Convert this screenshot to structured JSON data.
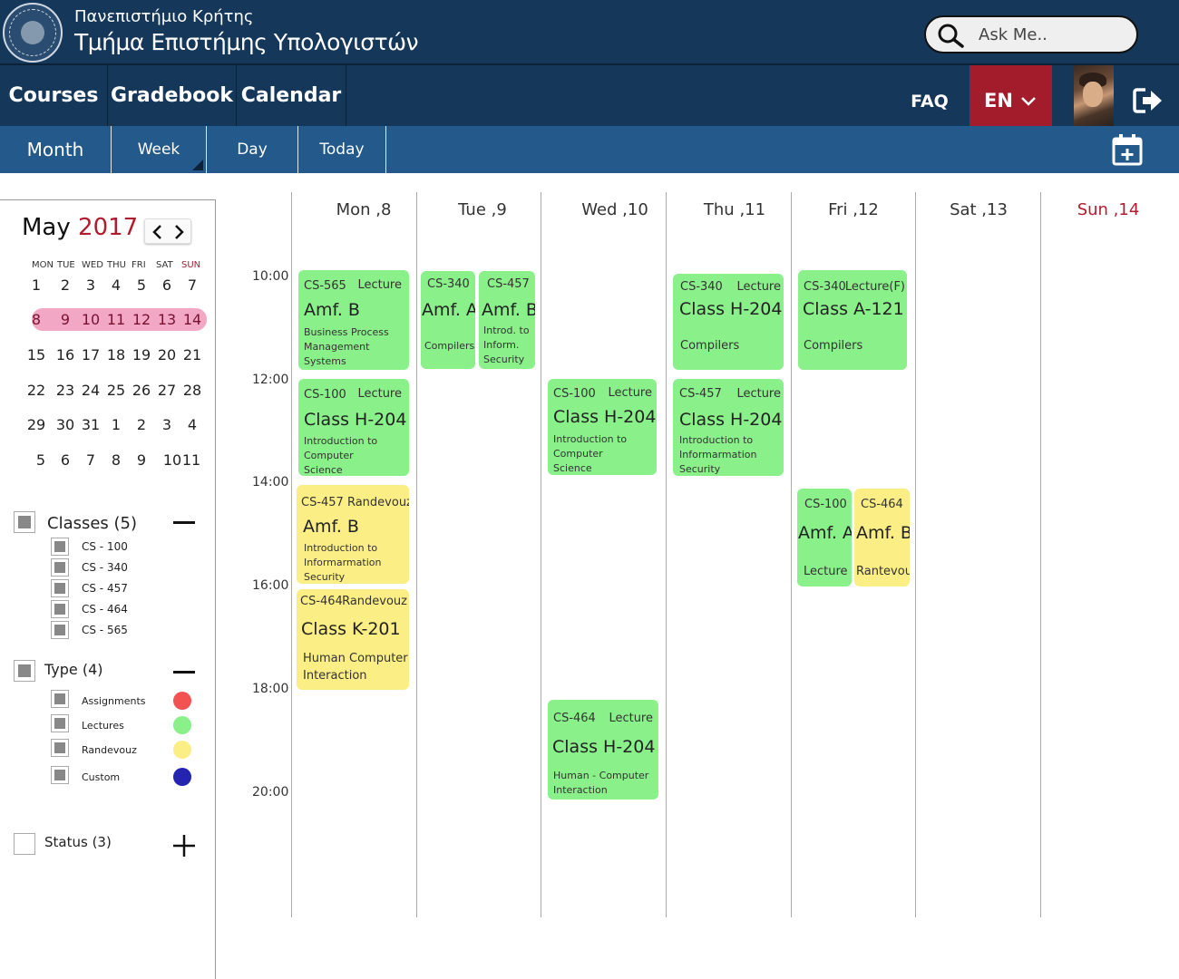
{
  "header": {
    "university": "Πανεπιστήμιο Κρήτης",
    "department": "Τμήμα Επιστήμης Υπολογιστών",
    "search_placeholder": "Ask Me.."
  },
  "nav": {
    "courses": "Courses",
    "gradebook": "Gradebook",
    "calendar": "Calendar",
    "faq": "FAQ",
    "language": "EN"
  },
  "views": {
    "month": "Month",
    "week": "Week",
    "day": "Day",
    "today": "Today"
  },
  "mini_calendar": {
    "month": "May",
    "year": "2017",
    "weekdays": [
      "MON",
      "TUE",
      "WED",
      "THU",
      "FRI",
      "SAT",
      "SUN"
    ],
    "weeks": [
      [
        "1",
        "2",
        "3",
        "4",
        "5",
        "6",
        "7"
      ],
      [
        "8",
        "9",
        "10",
        "11",
        "12",
        "13",
        "14"
      ],
      [
        "15",
        "16",
        "17",
        "18",
        "19",
        "20",
        "21"
      ],
      [
        "22",
        "23",
        "24",
        "25",
        "26",
        "27",
        "28"
      ],
      [
        "29",
        "30",
        "31",
        "1",
        "2",
        "3",
        "4"
      ],
      [
        "5",
        "6",
        "7",
        "8",
        "9",
        "10",
        "11"
      ]
    ]
  },
  "filters": {
    "classes_title": "Classes (5)",
    "classes": [
      "CS - 100",
      "CS - 340",
      "CS - 457",
      "CS - 464",
      "CS - 565"
    ],
    "type_title": "Type (4)",
    "types": [
      {
        "label": "Assignments",
        "color": "#f25252"
      },
      {
        "label": "Lectures",
        "color": "#8af08a"
      },
      {
        "label": "Randevouz",
        "color": "#fbee84"
      },
      {
        "label": "Custom",
        "color": "#2424b0"
      }
    ],
    "status_title": "Status (3)"
  },
  "week": {
    "days": [
      "Mon ,8",
      "Tue ,9",
      "Wed ,10",
      "Thu ,11",
      "Fri ,12",
      "Sat ,13",
      "Sun ,14"
    ],
    "times": [
      "10:00",
      "12:00",
      "14:00",
      "16:00",
      "18:00",
      "20:00"
    ]
  },
  "events": [
    {
      "code": "CS-565",
      "kind": "Lecture",
      "room": "Amf. B",
      "desc": "Business Process\nManagement\nSystems"
    },
    {
      "code": "CS-100",
      "kind": "Lecture",
      "room": "Class H-204",
      "desc": "Introduction to\nComputer\nScience"
    },
    {
      "code": "CS-457 Randevouz",
      "kind": "",
      "room": "Amf. B",
      "desc": "Introduction to\nInformarmation\nSecurity"
    },
    {
      "code": "CS-464",
      "kind": "Randevouz",
      "room": "Class K-201",
      "desc": "Human Computer\nInteraction"
    },
    {
      "code": "CS-340",
      "kind": "",
      "room": "Amf. A",
      "desc": "Compilers"
    },
    {
      "code": "CS-457",
      "kind": "",
      "room": "Amf. B",
      "desc": "Introd. to\nInform.\nSecurity"
    },
    {
      "code": "CS-100",
      "kind": "Lecture",
      "room": "Class H-204",
      "desc": "Introduction to\nComputer\nScience"
    },
    {
      "code": "CS-464",
      "kind": "Lecture",
      "room": "Class H-204",
      "desc": "Human - Computer\nInteraction"
    },
    {
      "code": "CS-340",
      "kind": "Lecture",
      "room": "Class H-204",
      "desc": "Compilers"
    },
    {
      "code": "CS-457",
      "kind": "Lecture",
      "room": "Class H-204",
      "desc": "Introduction to\nInformarmation\nSecurity"
    },
    {
      "code": "CS-340",
      "kind": "Lecture(F)",
      "room": "Class A-121",
      "desc": "Compilers"
    },
    {
      "code": "CS-100",
      "kind": "",
      "room": "Amf. A",
      "desc": "Lecture"
    },
    {
      "code": "CS-464",
      "kind": "",
      "room": "Amf. B",
      "desc": "Rantevou"
    }
  ]
}
